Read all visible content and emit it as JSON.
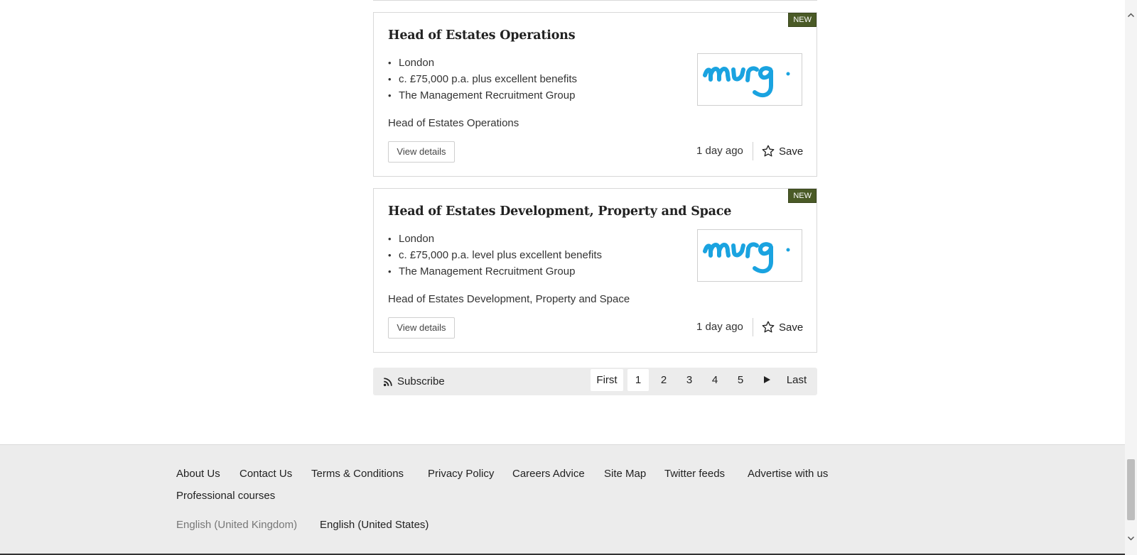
{
  "jobs": [
    {
      "badge": "NEW",
      "title": "Head of Estates Operations",
      "location": "London",
      "salary": "c. £75,000 p.a. plus excellent benefits",
      "recruiter": "The Management Recruitment Group",
      "description": "Head of Estates Operations",
      "logo_text": "mrg.",
      "view_label": "View details",
      "posted": "1 day ago",
      "save_label": "Save"
    },
    {
      "badge": "NEW",
      "title": "Head of Estates Development, Property and Space",
      "location": "London",
      "salary": "c. £75,000 p.a. level plus excellent benefits",
      "recruiter": "The Management Recruitment Group",
      "description": "Head of Estates Development, Property and Space",
      "logo_text": "mrg.",
      "view_label": "View details",
      "posted": "1 day ago",
      "save_label": "Save"
    }
  ],
  "pagination": {
    "subscribe_label": "Subscribe",
    "first_label": "First",
    "pages": [
      "1",
      "2",
      "3",
      "4",
      "5"
    ],
    "current_page": "1",
    "next_icon": "play-icon",
    "last_label": "Last"
  },
  "footer": {
    "links": [
      "About Us",
      "Contact Us",
      "Terms & Conditions",
      "Privacy Policy",
      "Careers Advice",
      "Site Map",
      "Twitter feeds",
      "Advertise with us",
      "Professional courses"
    ],
    "languages": {
      "current": "English (United Kingdom)",
      "other": "English (United States)"
    }
  },
  "colors": {
    "badge_bg": "#4a5a26",
    "logo_blue": "#1aa3e0",
    "footer_bg": "#ececec"
  }
}
